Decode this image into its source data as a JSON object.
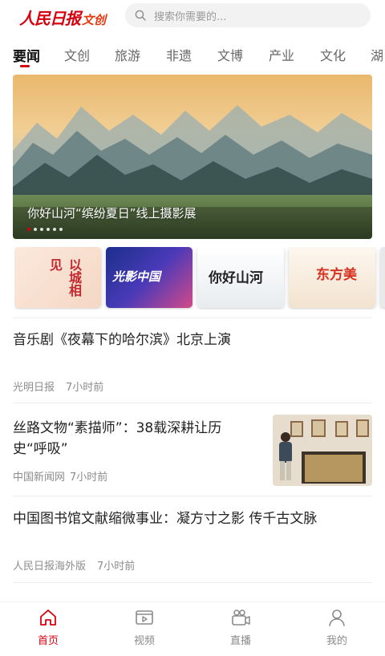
{
  "header": {
    "logo_main": "人民日报",
    "logo_sub": "文创",
    "search_placeholder": "搜索你需要的..."
  },
  "tabs": [
    "要闻",
    "文创",
    "旅游",
    "非遗",
    "文博",
    "产业",
    "文化",
    "湖"
  ],
  "active_tab": "要闻",
  "banner": {
    "caption": "你好山河“缤纷夏日”线上摄影展",
    "dot_count": 6,
    "active_dot": 1
  },
  "cards": [
    {
      "text": "以城相见"
    },
    {
      "text": "光影中国"
    },
    {
      "text": "你好山河"
    },
    {
      "text": "东方美"
    }
  ],
  "news": [
    {
      "title": "音乐剧《夜幕下的哈尔滨》北京上演",
      "source": "光明日报",
      "time": "7小时前"
    },
    {
      "title_line1": "丝路文物“素描师”：38载深耕让历",
      "title_line2": "史“呼吸”",
      "source": "中国新闻网",
      "time": "7小时前"
    },
    {
      "title": "中国图书馆文献缩微事业：凝方寸之影 传千古文脉",
      "source": "人民日报海外版",
      "time": "7小时前"
    }
  ],
  "bottom_nav": [
    {
      "label": "首页",
      "icon": "home-icon",
      "active": true
    },
    {
      "label": "视频",
      "icon": "video-icon",
      "active": false
    },
    {
      "label": "直播",
      "icon": "live-camera-icon",
      "active": false
    },
    {
      "label": "我的",
      "icon": "profile-icon",
      "active": false
    }
  ],
  "colors": {
    "brand_red": "#d7000f",
    "text_main": "#222222",
    "text_meta": "#8c8c8c"
  }
}
